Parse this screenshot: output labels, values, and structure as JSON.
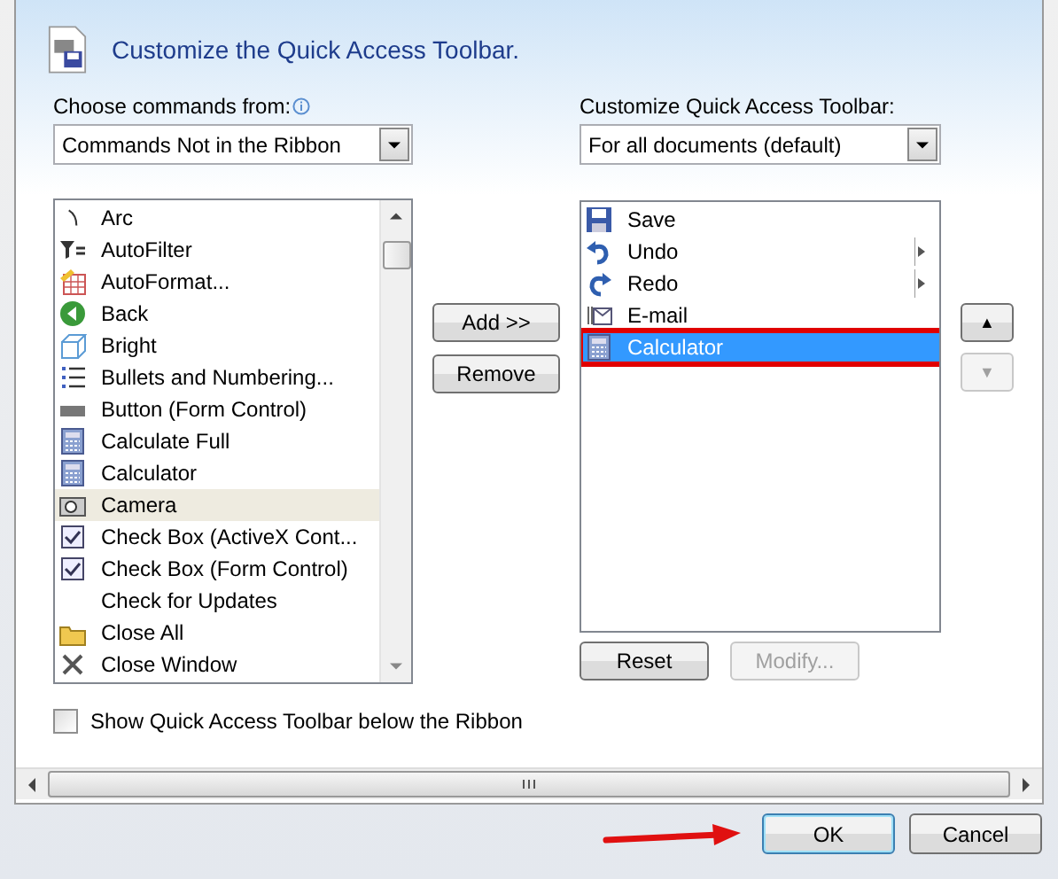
{
  "title": "Customize the Quick Access Toolbar.",
  "left": {
    "label": "Choose commands from:",
    "dropdown": "Commands Not in the Ribbon",
    "items": [
      {
        "label": "Arc",
        "selected": false
      },
      {
        "label": "AutoFilter",
        "selected": false
      },
      {
        "label": "AutoFormat...",
        "selected": false
      },
      {
        "label": "Back",
        "selected": false
      },
      {
        "label": "Bright",
        "selected": false
      },
      {
        "label": "Bullets and Numbering...",
        "selected": false
      },
      {
        "label": "Button (Form Control)",
        "selected": false
      },
      {
        "label": "Calculate Full",
        "selected": false
      },
      {
        "label": "Calculator",
        "selected": false
      },
      {
        "label": "Camera",
        "selected": true
      },
      {
        "label": "Check Box (ActiveX Cont...",
        "selected": false
      },
      {
        "label": "Check Box (Form Control)",
        "selected": false
      },
      {
        "label": "Check for Updates",
        "selected": false
      },
      {
        "label": "Close All",
        "selected": false
      },
      {
        "label": "Close Window",
        "selected": false
      }
    ]
  },
  "middle_buttons": [
    {
      "label": "Add >>",
      "disabled": false
    },
    {
      "label": "Remove",
      "disabled": false
    }
  ],
  "right": {
    "label": "Customize Quick Access Toolbar:",
    "dropdown": "For all documents (default)",
    "items": [
      {
        "label": "Save",
        "selected": false,
        "submenu": false,
        "annotated": false
      },
      {
        "label": "Undo",
        "selected": false,
        "submenu": true,
        "annotated": false
      },
      {
        "label": "Redo",
        "selected": false,
        "submenu": true,
        "annotated": false
      },
      {
        "label": "E-mail",
        "selected": false,
        "submenu": false,
        "annotated": false
      },
      {
        "label": "Calculator",
        "selected": true,
        "submenu": false,
        "annotated": true
      }
    ]
  },
  "move_buttons": [
    {
      "label": "▲",
      "disabled": false
    },
    {
      "label": "▼",
      "disabled": true
    }
  ],
  "right_buttons": [
    {
      "label": "Reset",
      "disabled": false
    },
    {
      "label": "Modify...",
      "disabled": true
    }
  ],
  "show_below": {
    "label": "Show Quick Access Toolbar below the Ribbon",
    "checked": false
  },
  "footer_buttons": [
    {
      "label": "OK",
      "default": true,
      "annotated": true
    },
    {
      "label": "Cancel",
      "default": false,
      "annotated": false
    }
  ]
}
